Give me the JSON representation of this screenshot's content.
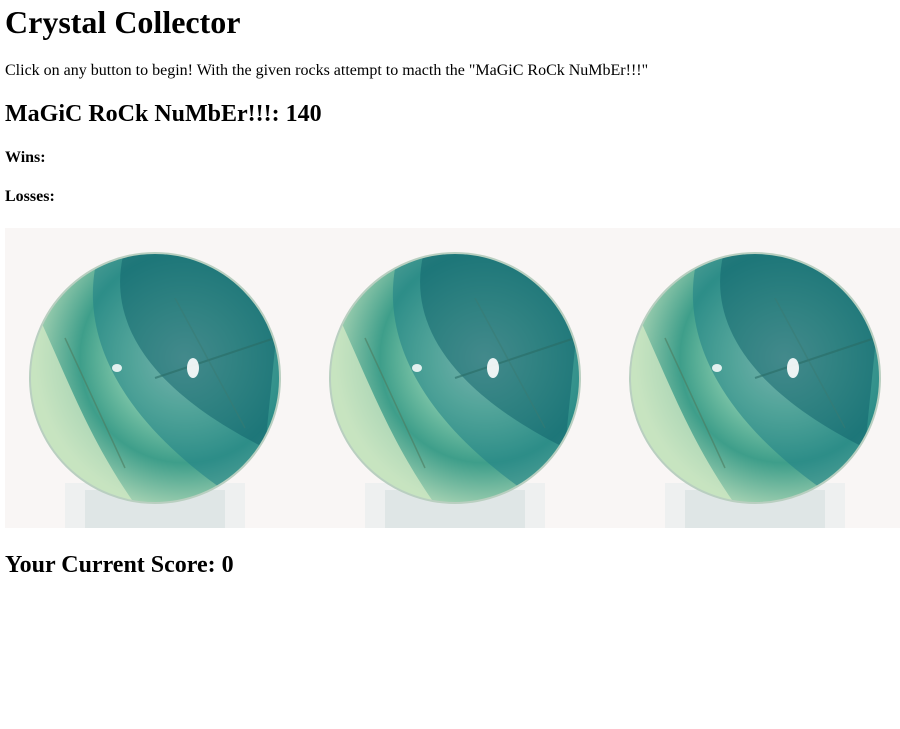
{
  "header": {
    "title": "Crystal Collector",
    "instructions": "Click on any button to begin! With the given rocks attempt to macth the \"MaGiC RoCk NuMbEr!!!\""
  },
  "magic": {
    "label": "MaGiC RoCk NuMbEr!!!:",
    "value": "140"
  },
  "stats": {
    "wins_label": "Wins:",
    "losses_label": "Losses:"
  },
  "crystals": [
    {
      "icon": "green-fluorite-sphere-icon"
    },
    {
      "icon": "green-fluorite-sphere-icon"
    },
    {
      "icon": "green-fluorite-sphere-icon"
    }
  ],
  "score": {
    "label": "Your Current Score:",
    "value": "0"
  },
  "colors": {
    "sphere_light": "#cfe8c4",
    "sphere_mid": "#5fb89a",
    "sphere_dark": "#0f6b6e",
    "background": "#f9f6f5"
  }
}
